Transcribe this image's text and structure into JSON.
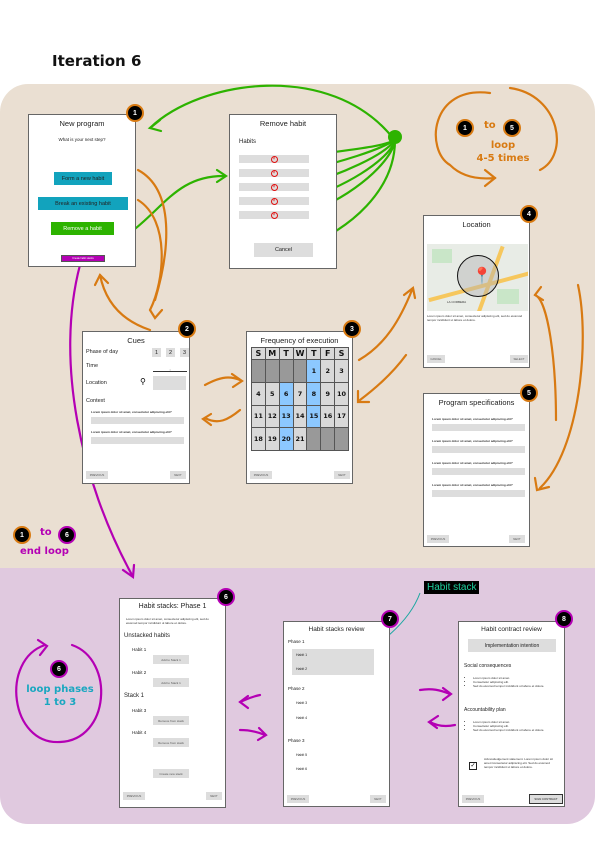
{
  "page_title": "Iteration 6",
  "sections": {
    "top_loop": {
      "from": "1",
      "connector": "to",
      "to": "5",
      "label_line1": "loop",
      "label_line2": "4-5 times"
    },
    "end_loop": {
      "from": "1",
      "connector": "to",
      "to": "6",
      "label": "end loop"
    },
    "phase_loop": {
      "badge": "6",
      "label_line1": "loop phases",
      "label_line2": "1 to 3"
    },
    "habit_stack_callout": "Habit stack"
  },
  "screens": {
    "new_program": {
      "badge": "1",
      "title": "New program",
      "prompt": "What is your next step?",
      "buttons": [
        "Form a new habit",
        "Break an existing habit",
        "Remove a habit",
        "Create habit stacks"
      ]
    },
    "remove_habit": {
      "title": "Remove habit",
      "list_label": "Habits",
      "rows": 5,
      "cancel": "Cancel"
    },
    "cues": {
      "badge": "2",
      "title": "Cues",
      "phase_label": "Phase of day",
      "phase_options": [
        "1",
        "2",
        "3"
      ],
      "time_label": "Time",
      "time_sep": ":",
      "location_label": "Location",
      "context_label": "Context",
      "questions": [
        "Lorem ipsum dolor sit amet, consectetur adipiscing elit?",
        "Lorem ipsum dolor sit amet, consectetur adipiscing elit?"
      ],
      "previous": "PREVIOUS",
      "next": "NEXT"
    },
    "frequency": {
      "badge": "3",
      "title": "Frequency of execution",
      "weekdays": [
        "S",
        "M",
        "T",
        "W",
        "T",
        "F",
        "S"
      ],
      "days": [
        "",
        "",
        "",
        "",
        "1",
        "2",
        "3",
        "4",
        "5",
        "6",
        "7",
        "8",
        "9",
        "10",
        "11",
        "12",
        "13",
        "14",
        "15",
        "16",
        "17",
        "18",
        "19",
        "20",
        "21",
        "",
        "",
        ""
      ],
      "selected": [
        "1",
        "6",
        "8",
        "13",
        "15",
        "20"
      ],
      "previous": "PREVIOUS",
      "next": "NEXT"
    },
    "location": {
      "badge": "4",
      "title": "Location",
      "map_label": "LA CORBERA",
      "description": "Lorem ipsum dolor sit amet, consectetur adipiscing elit, sed do eiusmod tempor incididunt ut labore et dolore.",
      "cancel": "CANCEL",
      "select": "SELECT"
    },
    "program_specs": {
      "badge": "5",
      "title": "Program specifications",
      "questions": [
        "Lorem ipsum dolor sit amet, consectetur adipiscing elit?",
        "Lorem ipsum dolor sit amet, consectetur adipiscing elit?",
        "Lorem ipsum dolor sit amet, consectetur adipiscing elit?",
        "Lorem ipsum dolor sit amet, consectetur adipiscing elit?"
      ],
      "previous": "PREVIOUS",
      "next": "NEXT"
    },
    "habit_stacks_phase": {
      "badge": "6",
      "title": "Habit stacks: Phase 1",
      "intro": "Lorem ipsum dolor sit amet, consectetur adipiscing elit, sed do eiusmod tempor incididunt ut labore et dolore.",
      "unstacked_label": "Unstacked habits",
      "unstacked": [
        {
          "name": "Habit 1",
          "action": "Add to Stack 1"
        },
        {
          "name": "Habit 2",
          "action": "Add to Stack 1"
        }
      ],
      "stack_label": "Stack 1",
      "stacked": [
        {
          "name": "Habit 3",
          "action": "Remove from stack"
        },
        {
          "name": "Habit 4",
          "action": "Remove from stack"
        }
      ],
      "create": "Create new stack",
      "previous": "PREVIOUS",
      "next": "NEXT"
    },
    "stacks_review": {
      "badge": "7",
      "title": "Habit stacks review",
      "phases": [
        {
          "label": "Phase 1",
          "habits": [
            "Habit 1",
            "Habit 2"
          ]
        },
        {
          "label": "Phase 2",
          "habits": [
            "Habit 3",
            "Habit 4"
          ]
        },
        {
          "label": "Phase 3",
          "habits": [
            "Habit 5",
            "Habit 6"
          ]
        }
      ],
      "previous": "PREVIOUS",
      "next": "NEXT"
    },
    "contract_review": {
      "badge": "8",
      "title": "Habit contract review",
      "implementation": "Implementation intention",
      "social_label": "Social consequences",
      "social_items": [
        "Lorem ipsum dolor sit amet.",
        "Consectetur adipiscing elit.",
        "Sed do eiusmod tempor incididunt ut labore et dolore."
      ],
      "accountability_label": "Accountability plan",
      "accountability_items": [
        "Lorem ipsum dolor sit amet.",
        "Consectetur adipiscing elit.",
        "Sed do eiusmod tempor incididunt ut labore et dolore."
      ],
      "acknowledgement": "Acknowledgement statement. Lorem ipsum dolor sit amet.Consectetur adipiscing elit. Sed do eiusmod tempor incididunt ut labore et dolore.",
      "acknowledged": true,
      "previous": "PREVIOUS",
      "sign": "SIGN CONTRACT"
    }
  },
  "colors": {
    "orange": "#d87a12",
    "green": "#2db300",
    "magenta": "#b400b4",
    "teal": "#1aa7c0",
    "selected_day": "#8cc8ff",
    "callout_text": "#1fd1a0"
  }
}
